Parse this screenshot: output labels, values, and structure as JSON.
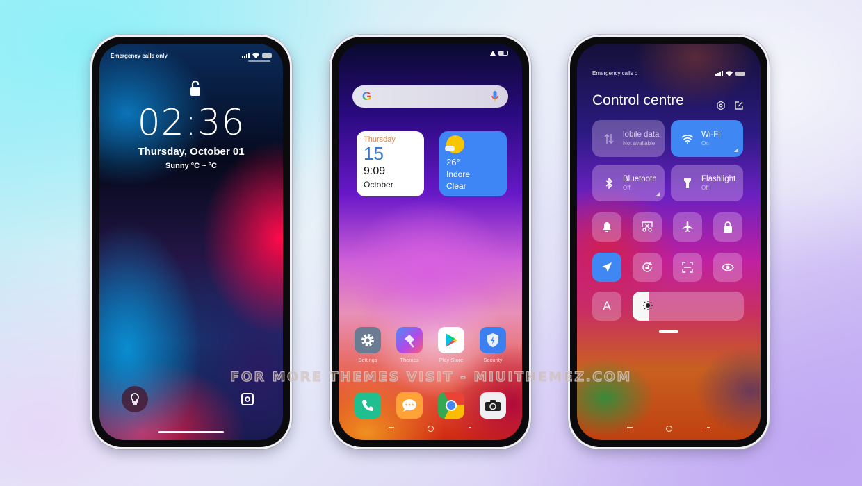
{
  "lockscreen": {
    "status_left": "Emergency calls only",
    "time": "02:36",
    "date": "Thursday, October 01",
    "weather": "Sunny  °C ~ °C",
    "left_shortcut_icon": "lightbulb-icon",
    "right_shortcut_icon": "camera-icon",
    "lock_icon": "unlocked-padlock-icon"
  },
  "homescreen": {
    "search_logo": "G",
    "search_icon": "microphone-icon",
    "calendar_widget": {
      "day": "Thursday",
      "date": "15",
      "time": "9:09",
      "month": "October"
    },
    "weather_widget": {
      "temp": "26°",
      "city": "Indore",
      "condition": "Clear"
    },
    "apps": [
      {
        "label": "Settings",
        "icon": "gear-icon",
        "color": "#6b7c92"
      },
      {
        "label": "Themes",
        "icon": "paintbrush-icon",
        "color": "#8a5cf0"
      },
      {
        "label": "Play Store",
        "icon": "play-store-icon",
        "color": "#ffffff"
      },
      {
        "label": "Security",
        "icon": "shield-icon",
        "color": "#3b7ff0"
      }
    ],
    "dock": [
      {
        "icon": "phone-icon",
        "color": "#1fbf8f"
      },
      {
        "icon": "message-icon",
        "color": "#ffa238"
      },
      {
        "icon": "chrome-icon",
        "color": "#ffffff"
      },
      {
        "icon": "camera-icon",
        "color": "#f0f0f0"
      }
    ]
  },
  "control_centre": {
    "status_left": "Emergency calls o",
    "title": "Control centre",
    "tiles": [
      {
        "name": "Mobile data",
        "display_name": "lobile data",
        "status": "Not available",
        "on": false
      },
      {
        "name": "Wi-Fi",
        "display_name": "Wi-Fi",
        "status": "On",
        "on": true
      },
      {
        "name": "Bluetooth",
        "display_name": "Bluetooth",
        "status": "Off",
        "on": false
      },
      {
        "name": "Flashlight",
        "display_name": "Flashlight",
        "status": "Off",
        "on": false
      }
    ],
    "quick_toggles": [
      {
        "icon": "bell-icon",
        "on": false
      },
      {
        "icon": "screenshot-icon",
        "on": false
      },
      {
        "icon": "airplane-icon",
        "on": false
      },
      {
        "icon": "lock-icon",
        "on": false
      },
      {
        "icon": "location-icon",
        "on": true
      },
      {
        "icon": "rotation-lock-icon",
        "on": false
      },
      {
        "icon": "scan-icon",
        "on": false
      },
      {
        "icon": "eye-icon",
        "on": false
      }
    ],
    "auto_brightness_label": "A",
    "brightness_level": 0.15
  },
  "watermark": "FOR MORE THEMES VISIT - MIUITHEMEZ.COM",
  "accent_colors": {
    "blue": "#3f88f4",
    "wifi_on": "#3f88f4"
  }
}
